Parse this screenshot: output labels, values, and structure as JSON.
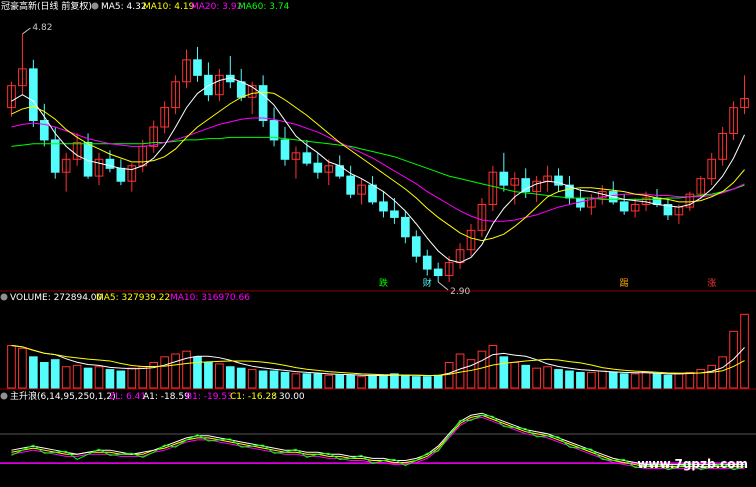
{
  "header_main": {
    "title": "冠豪高新(日线 前复权)",
    "ma5": "MA5: 4.32",
    "ma10": "MA10: 4.19",
    "ma20": "MA20: 3.92",
    "ma60": "MA60: 3.74"
  },
  "header_volume": {
    "title": "VOLUME: 272894.00",
    "ma5": "MA5: 327939.22",
    "ma10": "MA10: 316970.66"
  },
  "header_indicator": {
    "title": "主升浪(6,14,95,250,1,2)",
    "zl": "ZL: 6.41",
    "a1": "A1: -18.59",
    "b1": "B1: -19.53",
    "c1": "C1: -16.28",
    "extra": ": 30.00"
  },
  "annotations": {
    "high_label": "4.82",
    "low_label": "2.90",
    "markers": [
      "跌",
      "财",
      "踢",
      "涨"
    ]
  },
  "watermark": "www.7gpzb.com",
  "colors": {
    "up": "#ff3232",
    "down": "#54fcfc",
    "ma5": "#ffffff",
    "ma10": "#ffff00",
    "ma20": "#ff00ff",
    "ma60": "#00ff00",
    "c1": "#ff00ff",
    "zl": "#ffffff",
    "a1": "#ffff00",
    "b1": "#ff00ff",
    "frame": "#8b0000"
  },
  "chart_data": {
    "type": "candlestick",
    "title": "冠豪高新(日线 前复权)",
    "price_range": [
      2.9,
      4.82
    ],
    "price_ticks": [],
    "candles": [
      [
        4.25,
        4.45,
        4.18,
        4.42
      ],
      [
        4.42,
        4.82,
        4.35,
        4.55
      ],
      [
        4.55,
        4.62,
        4.1,
        4.15
      ],
      [
        4.15,
        4.28,
        3.95,
        4.0
      ],
      [
        4.0,
        4.1,
        3.7,
        3.75
      ],
      [
        3.75,
        3.9,
        3.6,
        3.85
      ],
      [
        3.85,
        4.05,
        3.8,
        3.98
      ],
      [
        3.98,
        4.05,
        3.7,
        3.72
      ],
      [
        3.72,
        3.9,
        3.65,
        3.85
      ],
      [
        3.85,
        3.92,
        3.75,
        3.78
      ],
      [
        3.78,
        3.85,
        3.65,
        3.68
      ],
      [
        3.68,
        3.82,
        3.6,
        3.8
      ],
      [
        3.8,
        4.0,
        3.75,
        3.95
      ],
      [
        3.95,
        4.15,
        3.9,
        4.1
      ],
      [
        4.1,
        4.3,
        4.05,
        4.25
      ],
      [
        4.25,
        4.5,
        4.2,
        4.45
      ],
      [
        4.45,
        4.7,
        4.4,
        4.62
      ],
      [
        4.62,
        4.72,
        4.45,
        4.5
      ],
      [
        4.5,
        4.6,
        4.3,
        4.35
      ],
      [
        4.35,
        4.55,
        4.3,
        4.5
      ],
      [
        4.5,
        4.65,
        4.4,
        4.45
      ],
      [
        4.45,
        4.55,
        4.3,
        4.33
      ],
      [
        4.33,
        4.45,
        4.2,
        4.42
      ],
      [
        4.42,
        4.5,
        4.1,
        4.15
      ],
      [
        4.15,
        4.25,
        3.95,
        4.0
      ],
      [
        4.0,
        4.1,
        3.8,
        3.85
      ],
      [
        3.85,
        3.95,
        3.7,
        3.9
      ],
      [
        3.9,
        4.0,
        3.8,
        3.82
      ],
      [
        3.82,
        3.9,
        3.7,
        3.75
      ],
      [
        3.75,
        3.85,
        3.65,
        3.8
      ],
      [
        3.8,
        3.88,
        3.7,
        3.72
      ],
      [
        3.72,
        3.8,
        3.55,
        3.58
      ],
      [
        3.58,
        3.7,
        3.5,
        3.65
      ],
      [
        3.65,
        3.72,
        3.5,
        3.52
      ],
      [
        3.52,
        3.6,
        3.4,
        3.45
      ],
      [
        3.45,
        3.55,
        3.35,
        3.4
      ],
      [
        3.4,
        3.45,
        3.2,
        3.25
      ],
      [
        3.25,
        3.3,
        3.05,
        3.1
      ],
      [
        3.1,
        3.15,
        2.95,
        3.0
      ],
      [
        3.0,
        3.05,
        2.9,
        2.95
      ],
      [
        2.95,
        3.1,
        2.9,
        3.05
      ],
      [
        3.05,
        3.2,
        3.0,
        3.15
      ],
      [
        3.15,
        3.35,
        3.1,
        3.3
      ],
      [
        3.3,
        3.55,
        3.25,
        3.5
      ],
      [
        3.5,
        3.8,
        3.45,
        3.75
      ],
      [
        3.75,
        3.9,
        3.6,
        3.65
      ],
      [
        3.65,
        3.75,
        3.5,
        3.7
      ],
      [
        3.7,
        3.78,
        3.55,
        3.6
      ],
      [
        3.6,
        3.72,
        3.52,
        3.68
      ],
      [
        3.68,
        3.8,
        3.6,
        3.72
      ],
      [
        3.72,
        3.78,
        3.6,
        3.65
      ],
      [
        3.65,
        3.72,
        3.5,
        3.55
      ],
      [
        3.55,
        3.62,
        3.45,
        3.48
      ],
      [
        3.48,
        3.58,
        3.42,
        3.55
      ],
      [
        3.55,
        3.65,
        3.5,
        3.6
      ],
      [
        3.6,
        3.68,
        3.5,
        3.52
      ],
      [
        3.52,
        3.58,
        3.42,
        3.45
      ],
      [
        3.45,
        3.55,
        3.4,
        3.5
      ],
      [
        3.5,
        3.6,
        3.45,
        3.55
      ],
      [
        3.55,
        3.62,
        3.48,
        3.5
      ],
      [
        3.5,
        3.55,
        3.38,
        3.42
      ],
      [
        3.42,
        3.5,
        3.35,
        3.48
      ],
      [
        3.48,
        3.6,
        3.45,
        3.58
      ],
      [
        3.58,
        3.72,
        3.55,
        3.7
      ],
      [
        3.7,
        3.9,
        3.65,
        3.85
      ],
      [
        3.85,
        4.1,
        3.8,
        4.05
      ],
      [
        4.05,
        4.3,
        4.0,
        4.25
      ],
      [
        4.25,
        4.5,
        4.2,
        4.32
      ]
    ],
    "ma5": [
      4.3,
      4.35,
      4.3,
      4.18,
      4.05,
      3.95,
      3.88,
      3.84,
      3.82,
      3.8,
      3.78,
      3.77,
      3.8,
      3.86,
      3.96,
      4.1,
      4.25,
      4.36,
      4.42,
      4.46,
      4.48,
      4.45,
      4.41,
      4.35,
      4.27,
      4.15,
      4.03,
      3.96,
      3.9,
      3.83,
      3.8,
      3.74,
      3.7,
      3.65,
      3.6,
      3.53,
      3.45,
      3.35,
      3.24,
      3.14,
      3.07,
      3.05,
      3.09,
      3.19,
      3.35,
      3.47,
      3.56,
      3.62,
      3.66,
      3.68,
      3.67,
      3.64,
      3.61,
      3.6,
      3.58,
      3.56,
      3.54,
      3.53,
      3.52,
      3.5,
      3.49,
      3.48,
      3.5,
      3.55,
      3.62,
      3.72,
      3.86,
      4.04
    ],
    "ma10": [
      4.2,
      4.24,
      4.26,
      4.22,
      4.16,
      4.08,
      4.02,
      3.97,
      3.93,
      3.89,
      3.86,
      3.83,
      3.83,
      3.84,
      3.87,
      3.93,
      4.02,
      4.1,
      4.16,
      4.22,
      4.28,
      4.33,
      4.36,
      4.37,
      4.36,
      4.31,
      4.25,
      4.19,
      4.12,
      4.05,
      3.98,
      3.92,
      3.86,
      3.8,
      3.74,
      3.68,
      3.62,
      3.55,
      3.47,
      3.4,
      3.34,
      3.28,
      3.24,
      3.22,
      3.24,
      3.27,
      3.33,
      3.4,
      3.48,
      3.56,
      3.6,
      3.62,
      3.63,
      3.63,
      3.62,
      3.61,
      3.6,
      3.58,
      3.57,
      3.55,
      3.54,
      3.52,
      3.52,
      3.53,
      3.56,
      3.6,
      3.67,
      3.77
    ],
    "ma20": [
      4.1,
      4.12,
      4.13,
      4.12,
      4.1,
      4.07,
      4.04,
      4.01,
      3.99,
      3.97,
      3.96,
      3.95,
      3.95,
      3.96,
      3.98,
      4.0,
      4.03,
      4.06,
      4.09,
      4.12,
      4.14,
      4.16,
      4.17,
      4.17,
      4.16,
      4.14,
      4.12,
      4.09,
      4.06,
      4.02,
      3.98,
      3.94,
      3.9,
      3.86,
      3.81,
      3.76,
      3.71,
      3.66,
      3.6,
      3.55,
      3.5,
      3.45,
      3.41,
      3.38,
      3.37,
      3.37,
      3.38,
      3.4,
      3.42,
      3.45,
      3.48,
      3.5,
      3.52,
      3.54,
      3.56,
      3.57,
      3.58,
      3.58,
      3.58,
      3.57,
      3.57,
      3.56,
      3.56,
      3.56,
      3.57,
      3.59,
      3.62,
      3.66
    ],
    "ma60": [
      3.95,
      3.96,
      3.97,
      3.97,
      3.97,
      3.97,
      3.97,
      3.97,
      3.97,
      3.97,
      3.97,
      3.97,
      3.97,
      3.98,
      3.98,
      3.99,
      4.0,
      4.0,
      4.01,
      4.01,
      4.02,
      4.02,
      4.02,
      4.02,
      4.02,
      4.01,
      4.0,
      3.99,
      3.98,
      3.97,
      3.96,
      3.95,
      3.93,
      3.91,
      3.89,
      3.87,
      3.84,
      3.81,
      3.78,
      3.75,
      3.72,
      3.7,
      3.68,
      3.66,
      3.64,
      3.62,
      3.6,
      3.59,
      3.58,
      3.57,
      3.56,
      3.55,
      3.55,
      3.55,
      3.54,
      3.54,
      3.54,
      3.54,
      3.54,
      3.54,
      3.55,
      3.55,
      3.56,
      3.57,
      3.58,
      3.6,
      3.62,
      3.65
    ],
    "volume": [
      30,
      28,
      22,
      18,
      20,
      15,
      16,
      14,
      15,
      13,
      12,
      14,
      15,
      18,
      22,
      24,
      26,
      22,
      18,
      17,
      15,
      14,
      13,
      12,
      12,
      11,
      10,
      10,
      10,
      9,
      9,
      9,
      8,
      9,
      9,
      10,
      9,
      8,
      8,
      9,
      18,
      24,
      20,
      26,
      30,
      22,
      18,
      16,
      14,
      15,
      13,
      12,
      11,
      11,
      12,
      11,
      10,
      10,
      11,
      10,
      9,
      10,
      11,
      13,
      16,
      22,
      40,
      52
    ],
    "volume_max": 60,
    "indicator": {
      "range": [
        -25,
        12
      ],
      "zl": [
        -10,
        -9,
        -8,
        -9,
        -10,
        -11,
        -12,
        -11,
        -10,
        -10,
        -11,
        -12,
        -11,
        -10,
        -8,
        -6,
        -4,
        -3,
        -3,
        -4,
        -5,
        -6,
        -7,
        -8,
        -9,
        -10,
        -10,
        -11,
        -11,
        -12,
        -12,
        -13,
        -13,
        -14,
        -14,
        -15,
        -15,
        -14,
        -12,
        -8,
        -2,
        4,
        7,
        8,
        6,
        4,
        2,
        0,
        -1,
        -2,
        -4,
        -6,
        -8,
        -10,
        -12,
        -14,
        -15,
        -16,
        -17,
        -17,
        -17,
        -17,
        -17,
        -17,
        -17,
        -17,
        -17,
        -17
      ],
      "a1": [
        -11,
        -10,
        -9,
        -10,
        -11,
        -12,
        -12,
        -11,
        -11,
        -11,
        -12,
        -12,
        -12,
        -10,
        -9,
        -7,
        -5,
        -4,
        -4,
        -5,
        -6,
        -7,
        -8,
        -9,
        -10,
        -11,
        -11,
        -12,
        -12,
        -13,
        -13,
        -14,
        -14,
        -15,
        -15,
        -16,
        -16,
        -15,
        -13,
        -9,
        -3,
        3,
        6,
        7,
        5,
        3,
        1,
        -1,
        -2,
        -3,
        -5,
        -7,
        -9,
        -11,
        -13,
        -15,
        -16,
        -17,
        -18,
        -18,
        -18,
        -18,
        -18,
        -18,
        -18,
        -18,
        -18,
        -18
      ],
      "b1": [
        -12,
        -11,
        -10,
        -11,
        -12,
        -13,
        -13,
        -12,
        -12,
        -12,
        -13,
        -13,
        -13,
        -11,
        -10,
        -8,
        -6,
        -5,
        -5,
        -6,
        -7,
        -8,
        -9,
        -10,
        -11,
        -12,
        -12,
        -13,
        -13,
        -14,
        -14,
        -15,
        -15,
        -16,
        -16,
        -17,
        -17,
        -16,
        -14,
        -10,
        -4,
        2,
        5,
        6,
        4,
        2,
        0,
        -2,
        -3,
        -4,
        -6,
        -8,
        -10,
        -12,
        -14,
        -16,
        -17,
        -18,
        -19,
        -19,
        -19,
        -19,
        -19,
        -19,
        -19,
        -19,
        -19,
        -19
      ],
      "c1_level": -16.28
    }
  }
}
